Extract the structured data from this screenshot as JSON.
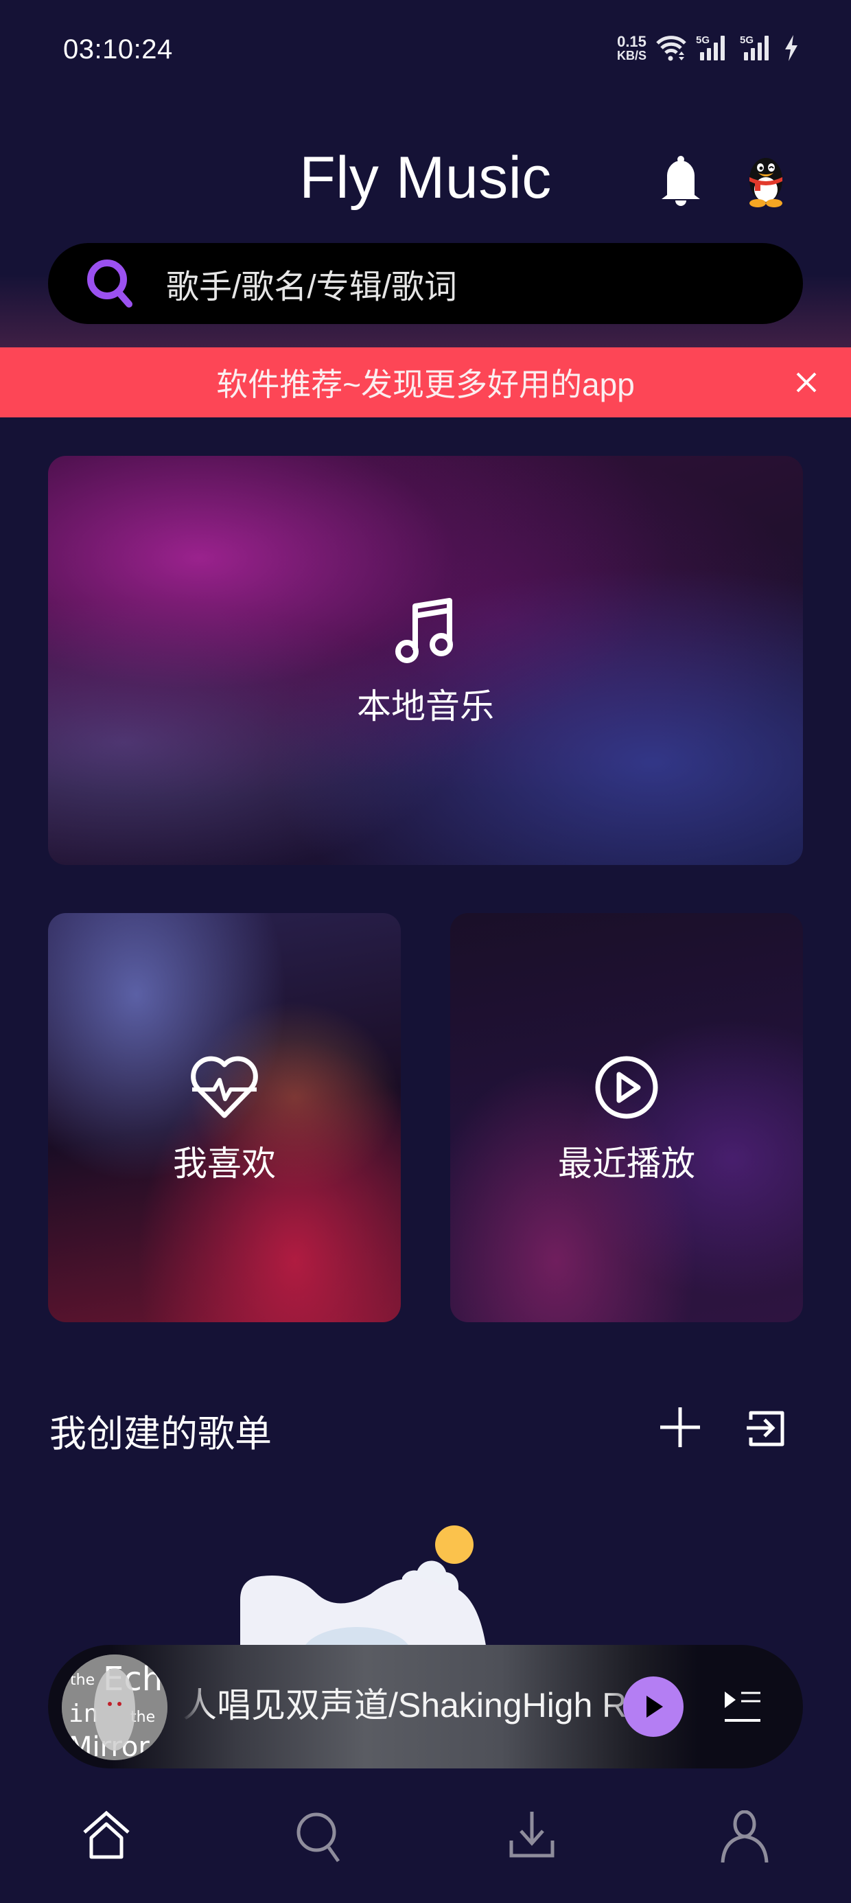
{
  "status_bar": {
    "time": "03:10:24",
    "net_speed_value": "0.15",
    "net_speed_unit": "KB/S",
    "signal1_label": "5G",
    "signal2_label": "5G",
    "icons": [
      "wifi-icon",
      "signal-5g-icon",
      "signal-5g-icon",
      "charging-icon"
    ]
  },
  "header": {
    "title": "Fly Music",
    "notification_icon": "bell-icon",
    "avatar_icon": "qq-penguin-avatar"
  },
  "search": {
    "placeholder": "歌手/歌名/专辑/歌词",
    "icon": "search-icon",
    "accent_color": "#9b51f0"
  },
  "promo_banner": {
    "text": "软件推荐~发现更多好用的app",
    "close_icon": "close-icon",
    "background_color": "#fd4656"
  },
  "cards": [
    {
      "label": "本地音乐",
      "icon": "music-note-icon"
    },
    {
      "label": "我喜欢",
      "icon": "heart-pulse-icon"
    },
    {
      "label": "最近播放",
      "icon": "play-circle-icon"
    }
  ],
  "playlists_section": {
    "title": "我创建的歌单",
    "add_icon": "plus-icon",
    "import_icon": "import-icon"
  },
  "mini_player": {
    "song_title": "人唱见双声道/ShakingHigh R",
    "play_icon": "play-icon",
    "playlist_icon": "playlist-icon",
    "album_art_text": "The Echo in the Mirror",
    "accent_color": "#b47ef3"
  },
  "bottom_nav": [
    {
      "name": "home",
      "icon": "home-icon",
      "active": true
    },
    {
      "name": "search",
      "icon": "search-icon",
      "active": false
    },
    {
      "name": "download",
      "icon": "download-icon",
      "active": false
    },
    {
      "name": "profile",
      "icon": "user-icon",
      "active": false
    }
  ]
}
